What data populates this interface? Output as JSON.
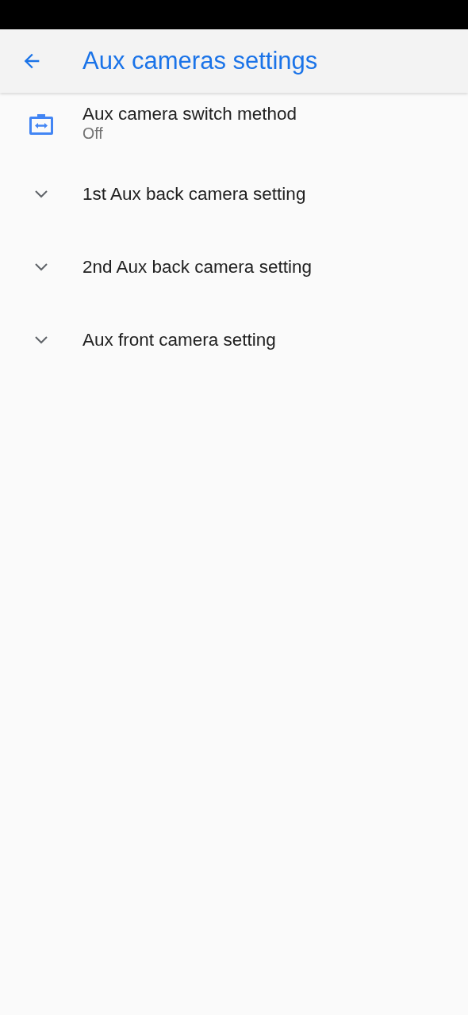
{
  "app_bar": {
    "title": "Aux cameras settings"
  },
  "items": [
    {
      "kind": "preference",
      "title": "Aux camera switch method",
      "summary": "Off"
    },
    {
      "kind": "category",
      "title": "1st Aux back camera setting",
      "expanded": false
    },
    {
      "kind": "category",
      "title": "2nd Aux back camera setting",
      "expanded": false
    },
    {
      "kind": "category",
      "title": "Aux front camera setting",
      "expanded": false
    }
  ]
}
